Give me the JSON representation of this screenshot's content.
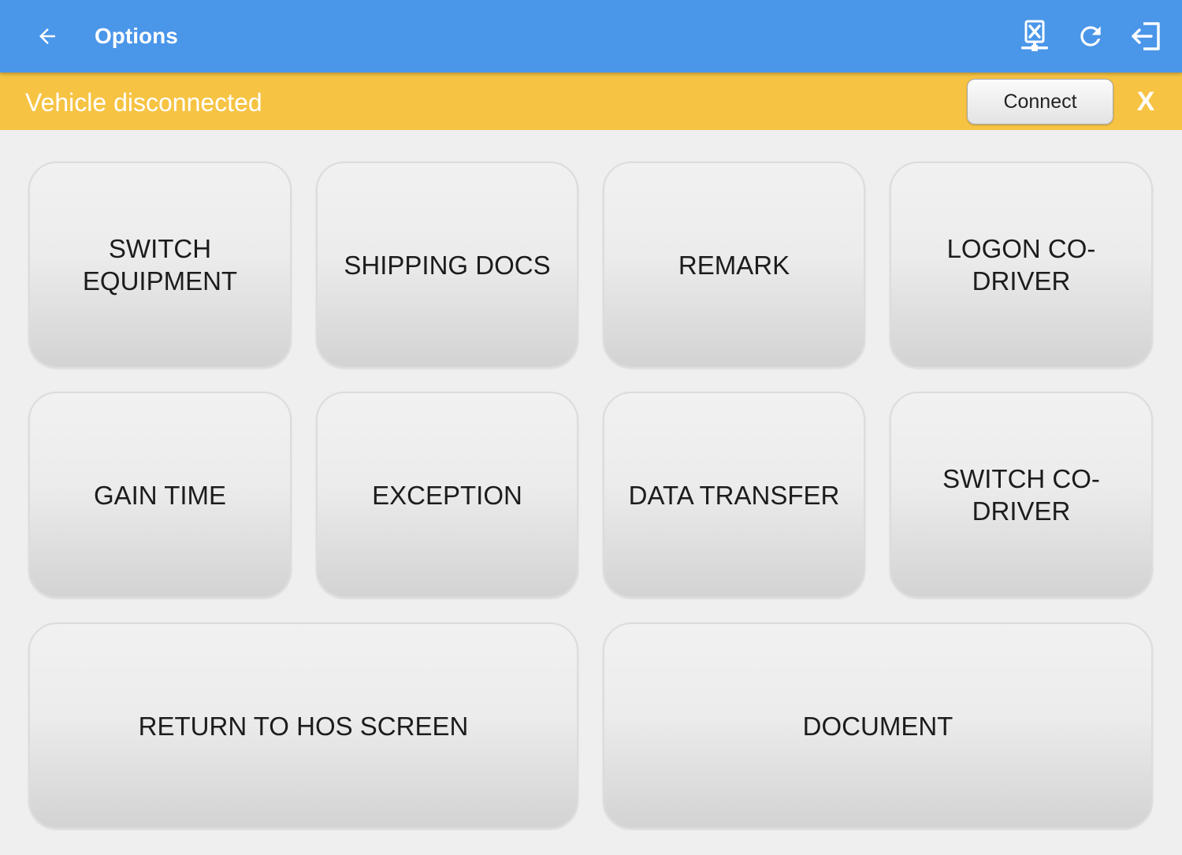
{
  "header": {
    "title": "Options",
    "back_icon": "arrow-left-icon",
    "actions": [
      {
        "icon": "network-disconnected-icon"
      },
      {
        "icon": "refresh-icon"
      },
      {
        "icon": "logout-icon"
      }
    ],
    "color": "#4a96e9"
  },
  "banner": {
    "message": "Vehicle disconnected",
    "connect_label": "Connect",
    "close_label": "X",
    "color": "#f6c343"
  },
  "tiles": [
    {
      "label": "SWITCH EQUIPMENT",
      "lines": [
        "SWITCH",
        "EQUIPMENT"
      ]
    },
    {
      "label": "SHIPPING DOCS"
    },
    {
      "label": "REMARK"
    },
    {
      "label": "LOGON CO-DRIVER"
    },
    {
      "label": "GAIN TIME"
    },
    {
      "label": "EXCEPTION"
    },
    {
      "label": "DATA TRANSFER"
    },
    {
      "label": "SWITCH CO-DRIVER",
      "lines": [
        "SWITCH CO-",
        "DRIVER"
      ]
    },
    {
      "label": "RETURN TO HOS SCREEN"
    },
    {
      "label": "DOCUMENT"
    }
  ]
}
